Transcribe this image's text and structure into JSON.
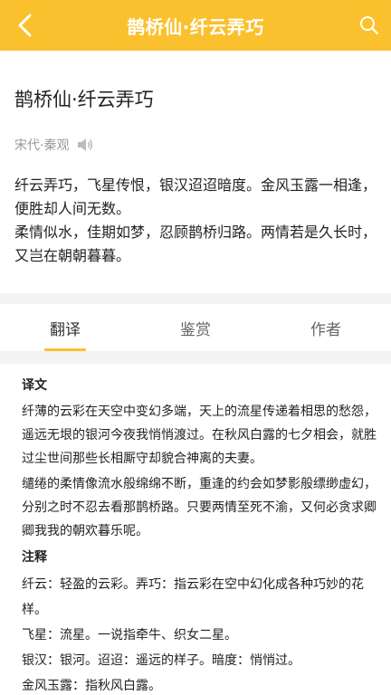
{
  "header": {
    "title": "鹊桥仙·纤云弄巧",
    "back_icon": "chevron-left-icon",
    "search_icon": "search-icon",
    "bg_color": "#FBC02D"
  },
  "poem": {
    "title": "鹊桥仙·纤云弄巧",
    "meta": "宋代·秦观",
    "speaker_icon": "speaker-icon",
    "lines": [
      "纤云弄巧，飞星传恨，银汉迢迢暗度。金风玉露一相逢，便胜却人间无数。",
      "柔情似水，佳期如梦，忍顾鹊桥归路。两情若是久长时，又岂在朝朝暮暮。"
    ]
  },
  "tabs": [
    {
      "label": "翻译",
      "active": true
    },
    {
      "label": "鉴赏",
      "active": false
    },
    {
      "label": "作者",
      "active": false
    }
  ],
  "content": {
    "translation_title": "译文",
    "translation": [
      "纤薄的云彩在天空中变幻多端，天上的流星传递着相思的愁怨，遥远无垠的银河今夜我悄悄渡过。在秋风白露的七夕相会，就胜过尘世间那些长相厮守却貌合神离的夫妻。",
      "缱绻的柔情像流水般绵绵不断，重逢的约会如梦影般缥缈虚幻，分别之时不忍去看那鹊桥路。只要两情至死不渝，又何必贪求卿卿我我的朝欢暮乐呢。"
    ],
    "notes_title": "注释",
    "notes": [
      "纤云：轻盈的云彩。弄巧：指云彩在空中幻化成各种巧妙的花样。",
      "飞星：流星。一说指牵牛、织女二星。",
      "银汉：银河。迢迢：遥远的样子。暗度：悄悄过。",
      "金风玉露：指秋风白露。"
    ]
  }
}
